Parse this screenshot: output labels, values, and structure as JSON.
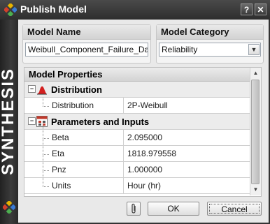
{
  "window": {
    "title": "Publish Model"
  },
  "titlebar": {
    "help_label": "?",
    "close_label": "✕"
  },
  "sidebar": {
    "brand": "SYNTHESIS"
  },
  "model_name": {
    "label": "Model Name",
    "value": "Weibull_Component_Failure_Data"
  },
  "model_category": {
    "label": "Model Category",
    "value": "Reliability",
    "dropdown_icon": "chevron-down-icon"
  },
  "properties": {
    "header": "Model Properties",
    "categories": [
      {
        "name": "Distribution",
        "expand": "−",
        "icon": "distribution-icon",
        "rows": [
          {
            "name": "Distribution",
            "value": "2P-Weibull"
          }
        ]
      },
      {
        "name": "Parameters and Inputs",
        "expand": "−",
        "icon": "parameters-icon",
        "rows": [
          {
            "name": "Beta",
            "value": "2.095000"
          },
          {
            "name": "Eta",
            "value": "1818.979558"
          },
          {
            "name": "Pnz",
            "value": "1.000000"
          },
          {
            "name": "Units",
            "value": "Hour (hr)"
          }
        ]
      }
    ]
  },
  "buttons": {
    "ok": "OK",
    "cancel": "Cancel"
  },
  "colors": {
    "title_bar": "#3a3a3a",
    "panel": "#e9e9e9",
    "sidebar": "#2e2e2e"
  }
}
